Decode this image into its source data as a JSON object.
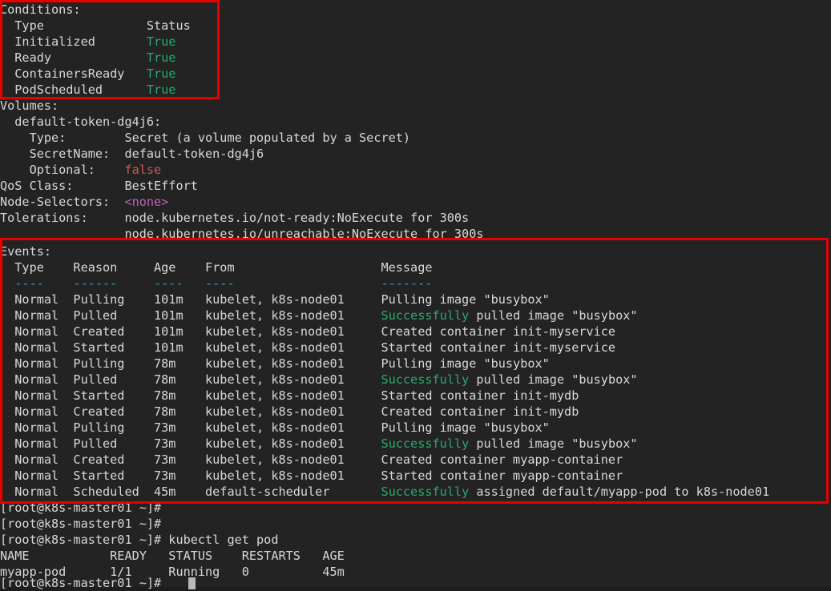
{
  "terminal": {
    "background": "#232323",
    "foreground": "#d8d8d8",
    "colors": {
      "green": "#2aa86f",
      "cyan": "#3a9bbf",
      "red": "#c25b5b",
      "magenta": "#c162b5",
      "annotation_box": "#e60000"
    },
    "prompt": "[root@k8s-master01 ~]#"
  },
  "conditions": {
    "heading": "Conditions:",
    "columns": {
      "type": "Type",
      "status": "Status"
    },
    "rows": [
      {
        "type": "Initialized",
        "status": "True"
      },
      {
        "type": "Ready",
        "status": "True"
      },
      {
        "type": "ContainersReady",
        "status": "True"
      },
      {
        "type": "PodScheduled",
        "status": "True"
      }
    ]
  },
  "volumes": {
    "heading": "Volumes:",
    "name": "default-token-dg4j6:",
    "fields": [
      {
        "label": "Type:",
        "value": "Secret (a volume populated by a Secret)"
      },
      {
        "label": "SecretName:",
        "value": "default-token-dg4j6"
      },
      {
        "label": "Optional:",
        "value": "false"
      }
    ]
  },
  "pod_meta": [
    {
      "label": "QoS Class:",
      "value": "BestEffort"
    },
    {
      "label": "Node-Selectors:",
      "value": "<none>"
    },
    {
      "label": "Tolerations:",
      "value": "node.kubernetes.io/not-ready:NoExecute for 300s"
    },
    {
      "label": "",
      "value": "node.kubernetes.io/unreachable:NoExecute for 300s"
    }
  ],
  "events": {
    "heading": "Events:",
    "columns": [
      "Type",
      "Reason",
      "Age",
      "From",
      "Message"
    ],
    "separators": [
      "----",
      "------",
      "----",
      "----",
      "-------"
    ],
    "rows": [
      {
        "type": "Normal",
        "reason": "Pulling",
        "age": "101m",
        "from": "kubelet, k8s-node01",
        "message_prefix": "",
        "message_highlight": "",
        "message": "Pulling image \"busybox\""
      },
      {
        "type": "Normal",
        "reason": "Pulled",
        "age": "101m",
        "from": "kubelet, k8s-node01",
        "message_highlight": "Successfully",
        "message_rest": " pulled image \"busybox\""
      },
      {
        "type": "Normal",
        "reason": "Created",
        "age": "101m",
        "from": "kubelet, k8s-node01",
        "message": "Created container init-myservice"
      },
      {
        "type": "Normal",
        "reason": "Started",
        "age": "101m",
        "from": "kubelet, k8s-node01",
        "message": "Started container init-myservice"
      },
      {
        "type": "Normal",
        "reason": "Pulling",
        "age": "78m",
        "from": "kubelet, k8s-node01",
        "message": "Pulling image \"busybox\""
      },
      {
        "type": "Normal",
        "reason": "Pulled",
        "age": "78m",
        "from": "kubelet, k8s-node01",
        "message_highlight": "Successfully",
        "message_rest": " pulled image \"busybox\""
      },
      {
        "type": "Normal",
        "reason": "Started",
        "age": "78m",
        "from": "kubelet, k8s-node01",
        "message": "Started container init-mydb"
      },
      {
        "type": "Normal",
        "reason": "Created",
        "age": "78m",
        "from": "kubelet, k8s-node01",
        "message": "Created container init-mydb"
      },
      {
        "type": "Normal",
        "reason": "Pulling",
        "age": "73m",
        "from": "kubelet, k8s-node01",
        "message": "Pulling image \"busybox\""
      },
      {
        "type": "Normal",
        "reason": "Pulled",
        "age": "73m",
        "from": "kubelet, k8s-node01",
        "message_highlight": "Successfully",
        "message_rest": " pulled image \"busybox\""
      },
      {
        "type": "Normal",
        "reason": "Created",
        "age": "73m",
        "from": "kubelet, k8s-node01",
        "message": "Created container myapp-container"
      },
      {
        "type": "Normal",
        "reason": "Started",
        "age": "73m",
        "from": "kubelet, k8s-node01",
        "message": "Started container myapp-container"
      },
      {
        "type": "Normal",
        "reason": "Scheduled",
        "age": "45m",
        "from": "default-scheduler",
        "message_highlight": "Successfully",
        "message_rest": " assigned default/myapp-pod to k8s-node01"
      }
    ]
  },
  "shell": {
    "blank_prompt_1": "[root@k8s-master01 ~]#",
    "blank_prompt_2": "[root@k8s-master01 ~]#",
    "command_line": "[root@k8s-master01 ~]# kubectl get pod",
    "command": "kubectl get pod",
    "get_pod_output": {
      "header": "NAME           READY   STATUS    RESTARTS   AGE",
      "columns": [
        "NAME",
        "READY",
        "STATUS",
        "RESTARTS",
        "AGE"
      ],
      "rows": [
        {
          "name": "myapp-pod",
          "ready": "1/1",
          "status": "Running",
          "restarts": "0",
          "age": "45m",
          "line": "myapp-pod      1/1     Running   0          45m"
        }
      ]
    },
    "final_prompt": "[root@k8s-master01 ~]#"
  },
  "rendered_lines": {
    "l0": "Conditions:",
    "l1": "  Type              Status",
    "l2p": "  Initialized       ",
    "l2v": "True",
    "l3p": "  Ready             ",
    "l3v": "True",
    "l4p": "  ContainersReady   ",
    "l4v": "True",
    "l5p": "  PodScheduled      ",
    "l5v": "True",
    "l6": "Volumes:",
    "l7": "  default-token-dg4j6:",
    "l8": "    Type:        Secret (a volume populated by a Secret)",
    "l9": "    SecretName:  default-token-dg4j6",
    "l10p": "    Optional:    ",
    "l10v": "false",
    "l11": "QoS Class:       BestEffort",
    "l12p": "Node-Selectors:  ",
    "l12v": "<none>",
    "l13": "Tolerations:     node.kubernetes.io/not-ready:NoExecute for 300s",
    "l14": "                 node.kubernetes.io/unreachable:NoExecute for 300s",
    "l15": "Events:",
    "l16": "  Type    Reason     Age    From                    Message",
    "l17": "  ----    ------     ----   ----                    -------",
    "e0": "  Normal  Pulling    101m   kubelet, k8s-node01     Pulling image \"busybox\"",
    "e1a": "  Normal  Pulled     101m   kubelet, k8s-node01     ",
    "e1b": "Successfully",
    "e1c": " pulled image \"busybox\"",
    "e2": "  Normal  Created    101m   kubelet, k8s-node01     Created container init-myservice",
    "e3": "  Normal  Started    101m   kubelet, k8s-node01     Started container init-myservice",
    "e4": "  Normal  Pulling    78m    kubelet, k8s-node01     Pulling image \"busybox\"",
    "e5a": "  Normal  Pulled     78m    kubelet, k8s-node01     ",
    "e5b": "Successfully",
    "e5c": " pulled image \"busybox\"",
    "e6": "  Normal  Started    78m    kubelet, k8s-node01     Started container init-mydb",
    "e7": "  Normal  Created    78m    kubelet, k8s-node01     Created container init-mydb",
    "e8": "  Normal  Pulling    73m    kubelet, k8s-node01     Pulling image \"busybox\"",
    "e9a": "  Normal  Pulled     73m    kubelet, k8s-node01     ",
    "e9b": "Successfully",
    "e9c": " pulled image \"busybox\"",
    "e10": "  Normal  Created    73m    kubelet, k8s-node01     Created container myapp-container",
    "e11": "  Normal  Started    73m    kubelet, k8s-node01     Started container myapp-container",
    "e12a": "  Normal  Scheduled  45m    default-scheduler       ",
    "e12b": "Successfully",
    "e12c": " assigned default/myapp-pod to k8s-node01",
    "s0": "[root@k8s-master01 ~]#",
    "s1": "[root@k8s-master01 ~]#",
    "s2": "[root@k8s-master01 ~]# kubectl get pod",
    "s3": "NAME           READY   STATUS    RESTARTS   AGE",
    "s4": "myapp-pod      1/1     Running   0          45m",
    "s5": "[root@k8s-master01 ~]#"
  }
}
